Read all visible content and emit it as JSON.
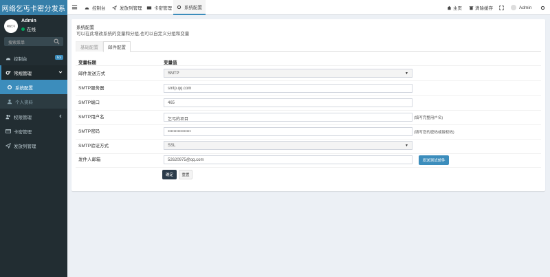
{
  "app": {
    "logo": "网络乞丐卡密分发系"
  },
  "user": {
    "avatar_text": "网络乞丐",
    "name": "Admin",
    "status": "在线"
  },
  "search": {
    "placeholder": "搜索菜单"
  },
  "sidebar": {
    "items": [
      {
        "label": "控制台",
        "badge": "hot",
        "icon": "dashboard-icon"
      },
      {
        "label": "常规管理",
        "icon": "cogs-icon"
      },
      {
        "label": "系统配置",
        "icon": "cog-icon"
      },
      {
        "label": "个人资料",
        "icon": "user-icon"
      },
      {
        "label": "权限管理",
        "icon": "users-icon"
      },
      {
        "label": "卡密管理",
        "icon": "card-icon"
      },
      {
        "label": "发放列管理",
        "icon": "send-icon"
      }
    ]
  },
  "topnav": {
    "tabs": [
      {
        "label": "控制台",
        "icon": "dashboard-icon"
      },
      {
        "label": "发放列管理",
        "icon": "send-icon"
      },
      {
        "label": "卡密管理",
        "icon": "card-icon"
      },
      {
        "label": "系统配置",
        "icon": "cog-icon"
      }
    ],
    "home": "主页",
    "clear_cache": "清除缓存",
    "admin": "Admin"
  },
  "content": {
    "title": "系统配置",
    "subtitle": "可以在此增改系统的变量和分组,也可以自定义分组和变量",
    "tabs": [
      "基础配置",
      "邮件配置"
    ],
    "col_name": "变量标题",
    "col_value": "变量值",
    "rows": [
      {
        "label": "邮件发送方式",
        "value": "SMTP",
        "type": "select",
        "hint": ""
      },
      {
        "label": "SMTP服务器",
        "value": "smtp.qq.com",
        "type": "input",
        "hint": ""
      },
      {
        "label": "SMTP端口",
        "value": "465",
        "type": "input",
        "hint": ""
      },
      {
        "label": "SMTP用户名",
        "value": "乞丐的项目",
        "type": "input",
        "hint": "(填写完整用户名)"
      },
      {
        "label": "SMTP密码",
        "value": "••••••••••••••••",
        "type": "input",
        "hint": "(填写您的密码或授权码)"
      },
      {
        "label": "SMTP验证方式",
        "value": "SSL",
        "type": "select",
        "hint": ""
      },
      {
        "label": "发件人邮箱",
        "value": "52620975@qq.com",
        "type": "input",
        "hint": ""
      }
    ],
    "test_button": "发送测试邮件",
    "confirm_button": "确定",
    "reset_button": "重置"
  },
  "colors": {
    "sidebar_bg": "#222d32",
    "logo_bg": "#367fa9",
    "accent": "#3c8dbc",
    "online": "#00a65a"
  }
}
